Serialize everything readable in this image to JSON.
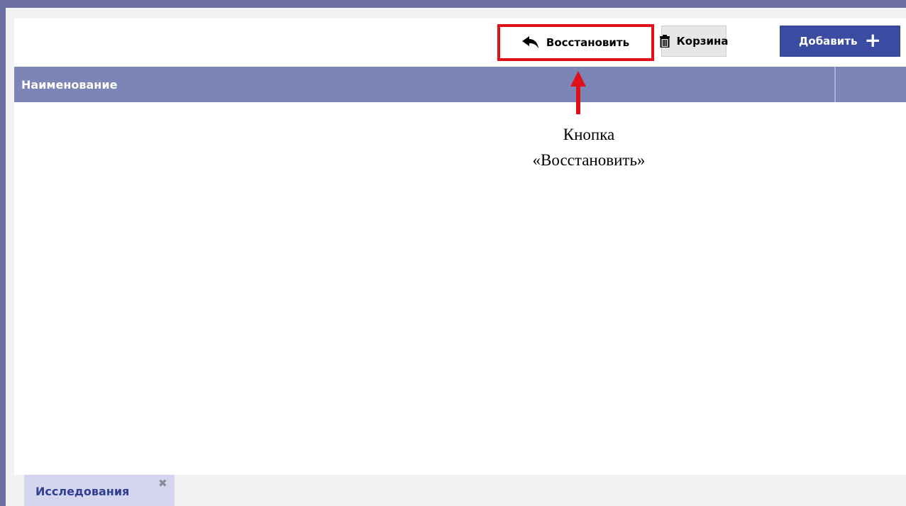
{
  "toolbar": {
    "restore_label": "Восстановить",
    "trash_label": "Корзина",
    "add_label": "Добавить",
    "add_symbol": "+"
  },
  "table": {
    "columns": [
      "Наименование",
      ""
    ],
    "rows": []
  },
  "annotation": {
    "line1": "Кнопка",
    "line2": "«Восстановить»",
    "color": "#e0101a"
  },
  "tabs": [
    {
      "label": "Исследования",
      "close_symbol": "✖"
    }
  ],
  "colors": {
    "header_bg": "#7c85b5",
    "add_button_bg": "#3b4ba1",
    "tab_bg": "#d4d6ef",
    "frame_border": "#6b6fa0"
  }
}
